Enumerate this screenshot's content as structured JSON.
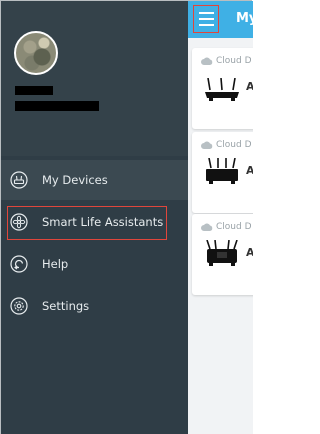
{
  "topbar": {
    "title": "My"
  },
  "drawer": {
    "nav": [
      {
        "label": "My Devices",
        "icon": "router-icon",
        "active": true
      },
      {
        "label": "Smart Life Assistants",
        "icon": "assistant-icon",
        "active": false
      },
      {
        "label": "Help",
        "icon": "help-icon",
        "active": false
      },
      {
        "label": "Settings",
        "icon": "settings-icon",
        "active": false
      }
    ]
  },
  "devices": [
    {
      "status": "Cloud D",
      "name": "A"
    },
    {
      "status": "Cloud D",
      "name": "A"
    },
    {
      "status": "Cloud D",
      "name": "A"
    }
  ],
  "colors": {
    "drawer_bg": "#2f3d46",
    "drawer_header_bg": "#34424a",
    "topbar_bg": "#3fb0e5",
    "highlight": "#e0463c"
  }
}
